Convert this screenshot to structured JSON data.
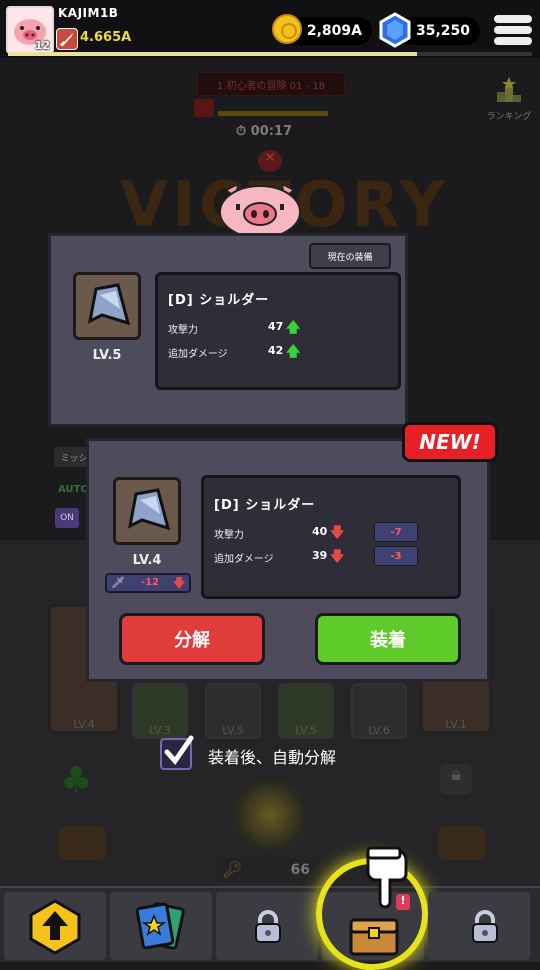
{
  "player": {
    "name": "KAJIM1B",
    "level": "12",
    "power": "4.665A"
  },
  "currency": {
    "gold": "2,809A",
    "gems": "35,250"
  },
  "background": {
    "stage": "1.初心者の冒険 01 - 18",
    "timer": "00:17",
    "ranking_label": "ランキング",
    "victory": "VICTORY",
    "count": "66",
    "slot_levels": [
      "LV.4",
      "LV.3",
      "LV.5",
      "LV.5",
      "LV.6",
      "LV.1"
    ],
    "side_labels": [
      "ミッシ",
      "AUTO",
      "ON"
    ]
  },
  "current_item": {
    "badge": "現在の装備",
    "name": "[D] ショルダー",
    "level": "LV.5",
    "stats": [
      {
        "label": "攻撃力",
        "value": "47",
        "arrow": "up"
      },
      {
        "label": "追加ダメージ",
        "value": "42",
        "arrow": "up"
      }
    ]
  },
  "new_item": {
    "badge": "NEW!",
    "name": "[D] ショルダー",
    "level": "LV.4",
    "power_delta": "-12",
    "stats": [
      {
        "label": "攻撃力",
        "value": "40",
        "arrow": "down",
        "diff": "-7"
      },
      {
        "label": "追加ダメージ",
        "value": "39",
        "arrow": "down",
        "diff": "-3"
      }
    ],
    "dismantle_label": "分解",
    "equip_label": "装着"
  },
  "auto_dismantle": {
    "label": "装着後、自動分解",
    "checked": true
  },
  "colors": {
    "dismantle": "#e03c3c",
    "equip": "#5fcb2b",
    "new_badge": "#e81f25",
    "up_arrow": "#37d33a",
    "down_arrow": "#e44a4a"
  },
  "icons": [
    "shoulder-armor-icon",
    "gold-coin-icon",
    "gem-icon",
    "menu-icon",
    "lock-icon",
    "cards-icon",
    "upgrade-arrow-icon",
    "chest-icon",
    "pointing-hand-icon",
    "sword-icon",
    "checkbox-icon"
  ]
}
